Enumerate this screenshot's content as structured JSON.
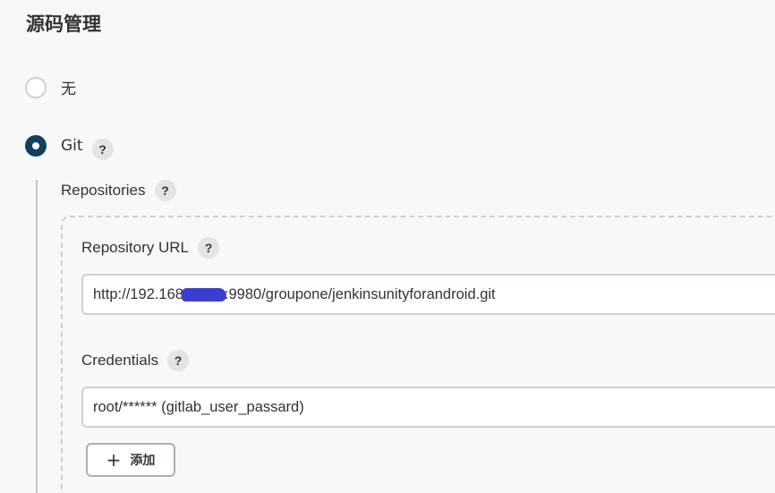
{
  "section": {
    "title": "源码管理"
  },
  "scm_options": [
    {
      "label": "无",
      "selected": false
    },
    {
      "label": "Git",
      "selected": true
    }
  ],
  "help_symbol": "?",
  "git": {
    "repositories_label": "Repositories",
    "repository_url": {
      "label": "Repository URL",
      "value_prefix": "http://192.168",
      "value_suffix": ":9980/groupone/jenkinsunityforandroid.git"
    },
    "credentials": {
      "label": "Credentials",
      "value": "root/****** (gitlab_user_passard)"
    },
    "add_button": {
      "icon": "plus-icon",
      "symbol": "+",
      "label": "添加"
    }
  },
  "colors": {
    "background": "#f8f8f8",
    "radio_checked": "#0f4060",
    "redaction": "#3a3fd0"
  }
}
